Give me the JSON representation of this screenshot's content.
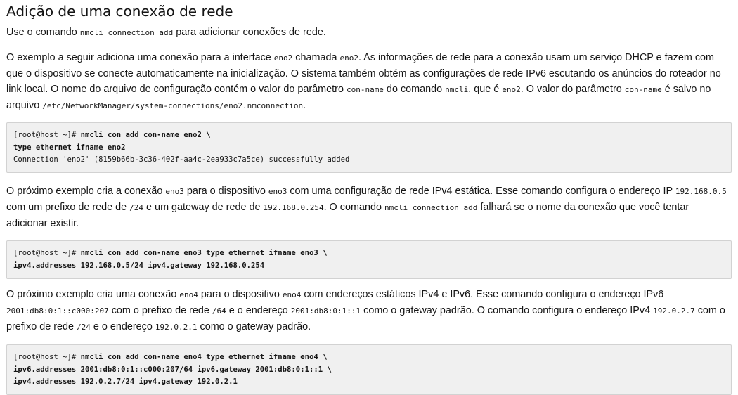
{
  "title": "Adição de uma conexão de rede",
  "intro": [
    "Use o comando ",
    "nmcli connection add",
    " para adicionar conexões de rede."
  ],
  "p1": [
    "O exemplo a seguir adiciona uma conexão para a interface ",
    "eno2",
    " chamada ",
    "eno2",
    ". As informações de rede para a conexão usam um serviço DHCP e fazem com que o dispositivo se conecte automaticamente na inicialização. O sistema também obtém as configurações de rede IPv6 escutando os anúncios do roteador no link local. O nome do arquivo de configuração contém o valor do parâmetro ",
    "con-name",
    " do comando ",
    "nmcli",
    ", que é ",
    "eno2",
    ". O valor do parâmetro ",
    "con-name",
    " é salvo no arquivo ",
    "/etc/NetworkManager/system-connections/eno2.nmconnection",
    "."
  ],
  "code1": {
    "line1_prompt": "[root@host ~]# ",
    "line1_cmd": "nmcli con add con-name eno2 \\",
    "line2_cmd": "type ethernet ifname eno2",
    "line3_out": "Connection 'eno2' (8159b66b-3c36-402f-aa4c-2ea933c7a5ce) successfully added"
  },
  "p2": [
    "O próximo exemplo cria a conexão ",
    "eno3",
    " para o dispositivo ",
    "eno3",
    " com uma configuração de rede IPv4 estática. Esse comando configura o endereço IP ",
    "192.168.0.5",
    " com um prefixo de rede de ",
    "/24",
    " e um gateway de rede de ",
    "192.168.0.254",
    ". O comando ",
    "nmcli connection add",
    " falhará se o nome da conexão que você tentar adicionar existir."
  ],
  "code2": {
    "line1_prompt": "[root@host ~]# ",
    "line1_cmd": "nmcli con add con-name eno3 type ethernet ifname eno3 \\",
    "line2_cmd": "ipv4.addresses 192.168.0.5/24 ipv4.gateway 192.168.0.254"
  },
  "p3": [
    "O próximo exemplo cria uma conexão ",
    "eno4",
    " para o dispositivo ",
    "eno4",
    " com endereços estáticos IPv4 e IPv6. Esse comando configura o endereço IPv6 ",
    "2001:db8:0:1::c000:207",
    " com o prefixo de rede ",
    "/64",
    " e o endereço ",
    "2001:db8:0:1::1",
    " como o gateway padrão. O comando configura o endereço IPv4 ",
    "192.0.2.7",
    " com o prefixo de rede ",
    "/24",
    " e o endereço ",
    "192.0.2.1",
    " como o gateway padrão."
  ],
  "code3": {
    "line1_prompt": "[root@host ~]# ",
    "line1_cmd": "nmcli con add con-name eno4 type ethernet ifname eno4 \\",
    "line2_cmd": "ipv6.addresses 2001:db8:0:1::c000:207/64 ipv6.gateway 2001:db8:0:1::1 \\",
    "line3_cmd": "ipv4.addresses 192.0.2.7/24 ipv4.gateway 192.0.2.1"
  }
}
